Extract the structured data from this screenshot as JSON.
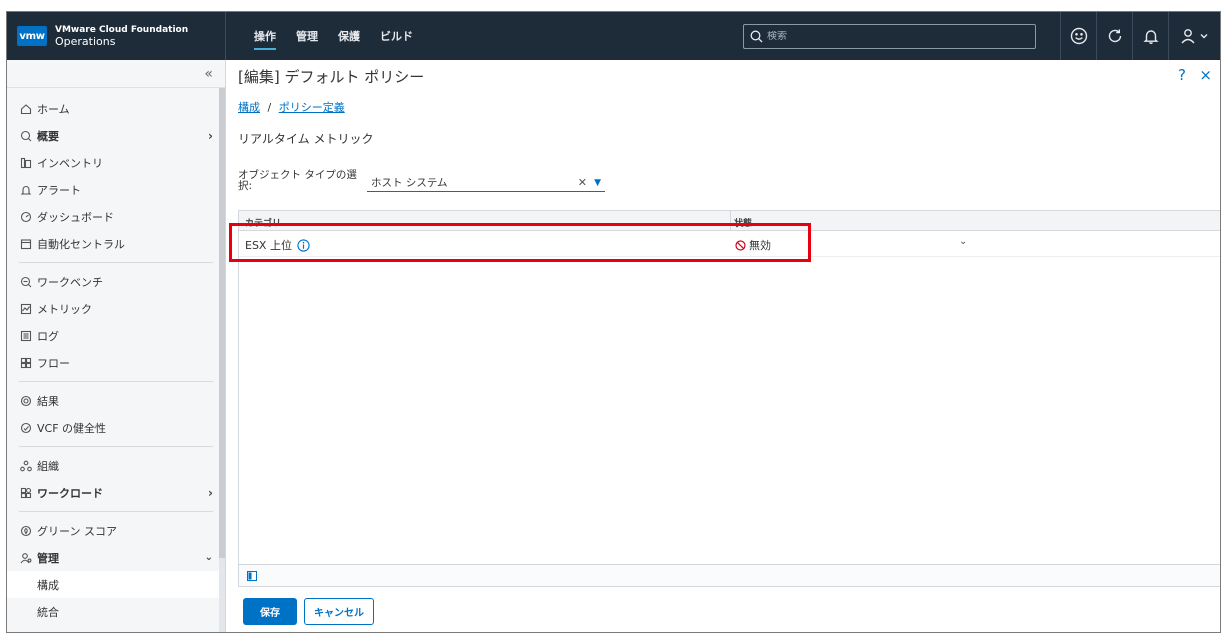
{
  "header": {
    "brand_line1": "VMware Cloud Foundation",
    "brand_line2": "Operations",
    "logo": "vmw",
    "nav": [
      "操作",
      "管理",
      "保護",
      "ビルド"
    ],
    "search_placeholder": "検索"
  },
  "sidebar": {
    "items": [
      {
        "label": "ホーム",
        "icon": "home-icon"
      },
      {
        "label": "概要",
        "icon": "overview-icon"
      },
      {
        "label": "インベントリ",
        "icon": "inventory-icon"
      },
      {
        "label": "アラート",
        "icon": "bell-icon"
      },
      {
        "label": "ダッシュボード",
        "icon": "dashboard-icon"
      },
      {
        "label": "自動化セントラル",
        "icon": "calendar-icon"
      },
      {
        "label": "ワークベンチ",
        "icon": "workbench-icon"
      },
      {
        "label": "メトリック",
        "icon": "metric-icon"
      },
      {
        "label": "ログ",
        "icon": "log-icon"
      },
      {
        "label": "フロー",
        "icon": "flow-icon"
      },
      {
        "label": "結果",
        "icon": "result-icon"
      },
      {
        "label": "VCF の健全性",
        "icon": "health-icon"
      },
      {
        "label": "組織",
        "icon": "org-icon"
      },
      {
        "label": "ワークロード",
        "icon": "workload-icon"
      },
      {
        "label": "グリーン スコア",
        "icon": "green-icon"
      },
      {
        "label": "管理",
        "icon": "admin-icon"
      }
    ],
    "sub_items": [
      "構成",
      "統合"
    ]
  },
  "main": {
    "title": "[編集] デフォルト ポリシー",
    "help": "?",
    "close": "×",
    "breadcrumb": {
      "item1": "構成",
      "separator": "/",
      "item2": "ポリシー定義"
    },
    "section_title": "リアルタイム メトリック",
    "object_type_label": "オブジェクト タイプの選択:",
    "object_type_value": "ホスト システム",
    "grid": {
      "columns": [
        "カテゴリ",
        "状態"
      ],
      "rows": [
        {
          "category": "ESX 上位",
          "state": "無効"
        }
      ]
    },
    "save_label": "保存",
    "cancel_label": "キャンセル"
  },
  "colors": {
    "header_bg": "#1e2c3a",
    "accent": "#0072c6",
    "highlight": "#e8000f",
    "disabled": "#d0021b"
  }
}
